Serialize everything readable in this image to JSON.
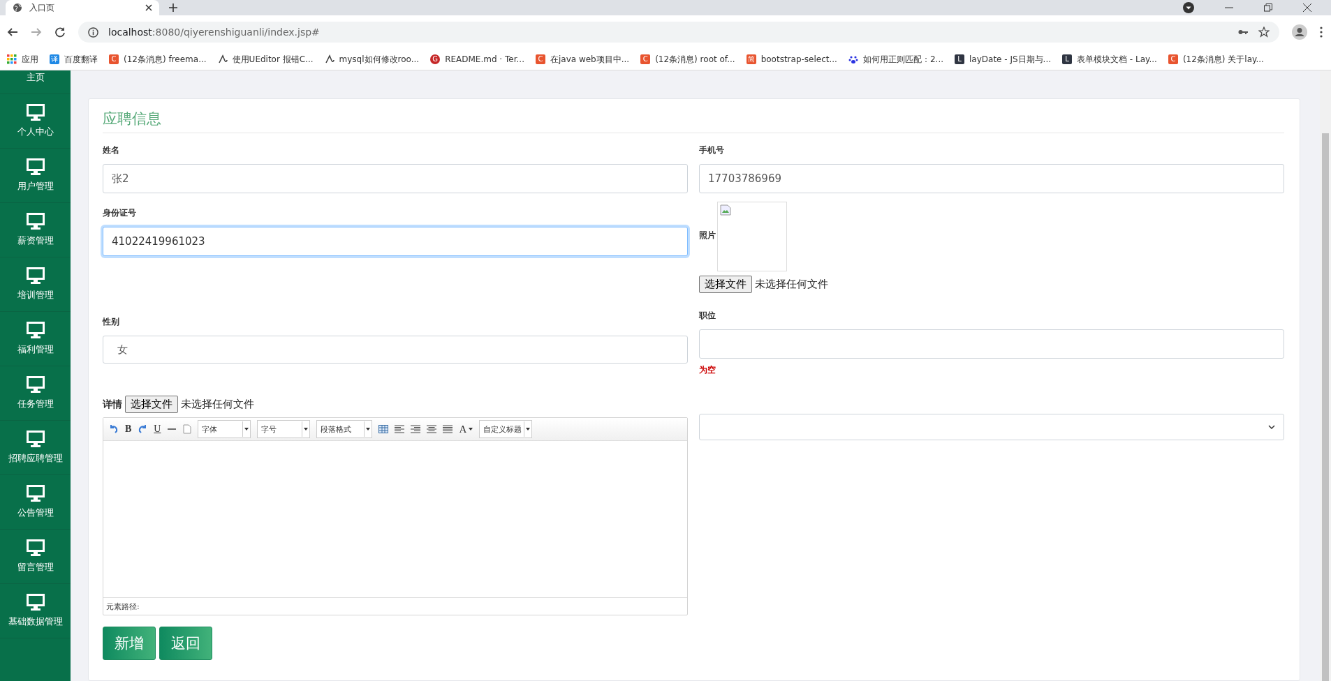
{
  "browser": {
    "tab_title": "入口页",
    "url_host": "localhost",
    "url_rest": ":8080/qiyerenshiguanli/index.jsp#",
    "bookmarks": [
      {
        "kind": "apps",
        "label": "应用"
      },
      {
        "kind": "translate",
        "logo": "译",
        "label": "百度翻译"
      },
      {
        "kind": "c",
        "logo": "C",
        "label": "(12条消息) freema..."
      },
      {
        "kind": "editor",
        "label": "使用UEditor 报错C..."
      },
      {
        "kind": "editor",
        "label": "mysql如何修改roo..."
      },
      {
        "kind": "git",
        "logo": "G",
        "label": "README.md · Ter..."
      },
      {
        "kind": "c",
        "logo": "C",
        "label": "在java web项目中..."
      },
      {
        "kind": "c",
        "logo": "C",
        "label": "(12条消息) root of..."
      },
      {
        "kind": "jian",
        "logo": "简",
        "label": "bootstrap-select..."
      },
      {
        "kind": "paw",
        "label": "如何用正则匹配：2..."
      },
      {
        "kind": "lay",
        "logo": "L",
        "label": "layDate - JS日期与..."
      },
      {
        "kind": "lay",
        "logo": "L",
        "label": "表单模块文档 - Lay..."
      },
      {
        "kind": "c",
        "logo": "C",
        "label": "(12条消息) 关于lay..."
      }
    ]
  },
  "sidebar": {
    "items": [
      {
        "label": "主页"
      },
      {
        "label": "个人中心"
      },
      {
        "label": "用户管理"
      },
      {
        "label": "薪资管理"
      },
      {
        "label": "培训管理"
      },
      {
        "label": "福利管理"
      },
      {
        "label": "任务管理"
      },
      {
        "label": "招聘应聘管理"
      },
      {
        "label": "公告管理"
      },
      {
        "label": "留言管理"
      },
      {
        "label": "基础数据管理"
      }
    ]
  },
  "form": {
    "title": "应聘信息",
    "name": {
      "label": "姓名",
      "value": "张2",
      "focused": false
    },
    "phone": {
      "label": "手机号",
      "value": "17703786969",
      "focused": false
    },
    "id_number": {
      "label": "身份证号",
      "value": "41022419961023",
      "focused": true
    },
    "photo": {
      "label": "照片",
      "button": "选择文件",
      "status": "未选择任何文件"
    },
    "gender": {
      "label": "性别",
      "value": "女"
    },
    "position": {
      "label": "职位",
      "error": "为空"
    },
    "details": {
      "label": "详情",
      "button": "选择文件",
      "status": "未选择任何文件"
    },
    "editor": {
      "bold": "B",
      "underline": "U",
      "font_color": "A",
      "dropdowns": [
        "字体",
        "字号",
        "段落格式"
      ],
      "custom_dropdown": "自定义标题",
      "path_label": "元素路径:"
    },
    "buttons": [
      "新增",
      "返回"
    ]
  }
}
